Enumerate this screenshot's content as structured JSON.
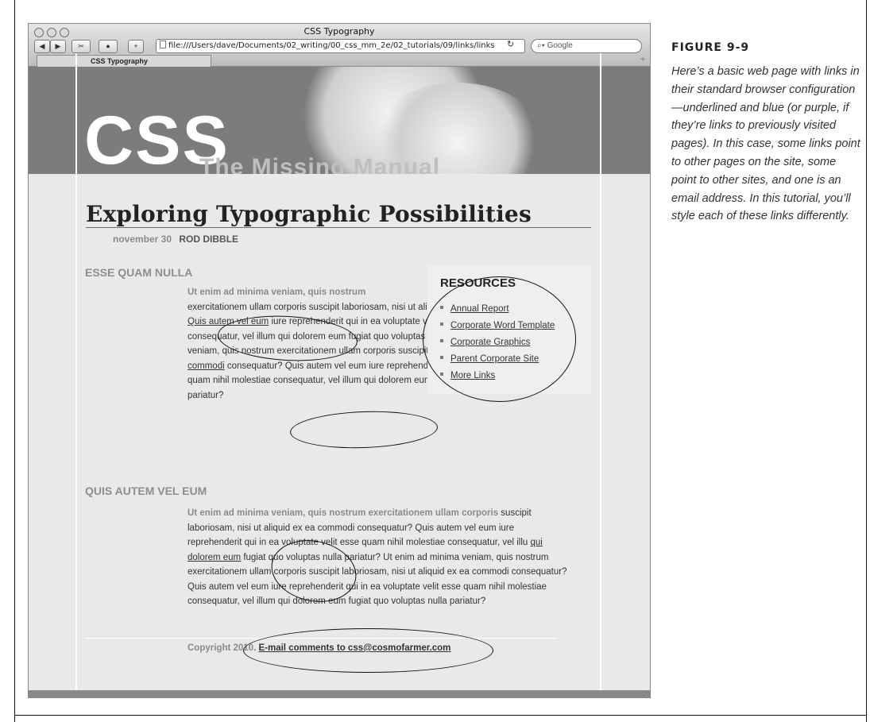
{
  "window": {
    "title": "CSS Typography",
    "url": "file:///Users/dave/Documents/02_writing/00_css_mm_2e/02_tutorials/09/links/links",
    "search_placeholder": "Google",
    "tab_label": "CSS Typography"
  },
  "banner": {
    "logo_text": "CSS",
    "subtitle": "The Missing Manual"
  },
  "article": {
    "title": "Exploring Typographic Possibilities",
    "date": "november 30",
    "author": "ROD DIBBLE",
    "section1": {
      "heading": "ESSE QUAM NULLA",
      "lead": "Ut enim ad minima veniam, quis nostrum",
      "text1": "exercitationem ullam corporis suscipit laboriosam, nisi ut aliquid ex ea commodi consequatur? ",
      "link1": "Quis autem vel eum",
      "text2": " iure reprehenderit qui in ea voluptate velit esse quam nihil molestiae consequatur, vel illum qui dolorem eum fugiat quo voluptas nulla pariatur? Ut enim ad minima veniam, quis nostrum exercitationem ullam corporis suscipit laboriosam, nisi ",
      "link2": "ut aliquid ex ea commodi",
      "text3": " consequatur? Quis autem vel eum iure reprehenderit qui in ea voluptate velit esse quam nihil molestiae consequatur, vel illum qui dolorem eum fugiat quo voluptas nulla pariatur?"
    },
    "section2": {
      "heading": "QUIS AUTEM VEL EUM",
      "lead": "Ut enim ad minima veniam, quis nostrum exercitationem ullam corporis",
      "text1": " suscipit laboriosam, nisi ut aliquid ex ea commodi consequatur? Quis autem vel eum iure reprehenderit qui in ea voluptate velit esse quam nihil molestiae consequatur, vel illu ",
      "link1": "qui dolorem eum",
      "text2": " fugiat quo voluptas nulla pariatur? Ut enim ad minima veniam, quis nostrum exercitationem ullam corporis suscipit laboriosam, nisi ut aliquid ex ea commodi consequatur? Quis autem vel eum iure reprehenderit qui in ea voluptate velit esse quam nihil molestiae consequatur, vel illum qui dolorem eum fugiat quo voluptas nulla pariatur?"
    }
  },
  "sidebar": {
    "title": "RESOURCES",
    "links": [
      "Annual Report",
      "Corporate Word Template",
      "Corporate Graphics",
      "Parent Corporate Site",
      "More Links"
    ]
  },
  "footer": {
    "copyright": "Copyright 2010. ",
    "email_link": "E-mail comments to css@cosmofarmer.com"
  },
  "figure": {
    "label": "FIGURE 9-9",
    "caption": "Here’s a basic web page with links in their standard browser configuration—underlined and blue (or purple, if they’re links to previously visited pages). In this case, some links point to other pages on the site, some point to other sites, and one is an email address. In this tutorial, you’ll style each of these links differently."
  },
  "icons": {
    "back": "back-arrow-icon",
    "forward": "forward-arrow-icon",
    "reload": "reload-icon",
    "search": "search-icon"
  }
}
